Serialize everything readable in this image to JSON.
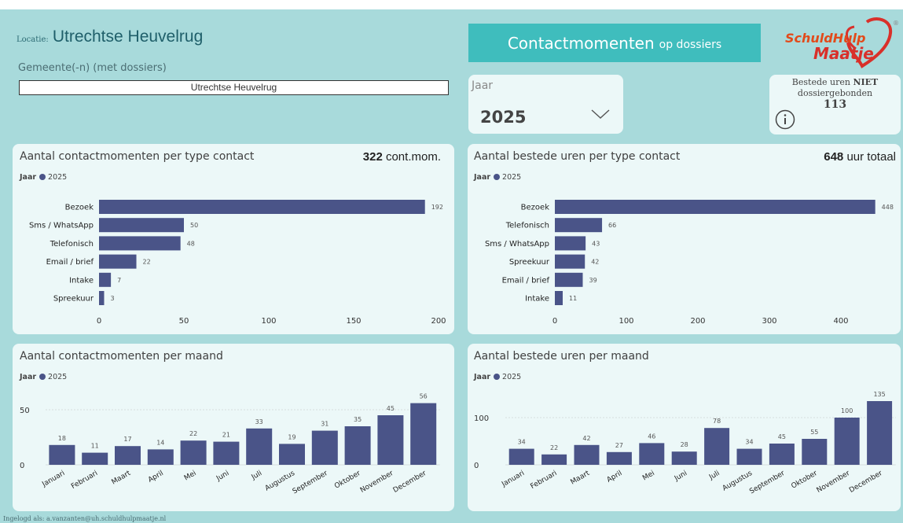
{
  "header": {
    "locatie_prefix": "Locatie:",
    "locatie_value": "Utrechtse Heuvelrug",
    "gemeente_label": "Gemeente(-n) (met dossiers)",
    "gemeente_value": "Utrechtse Heuvelrug",
    "title_main": "Contactmomenten",
    "title_sub": "op dossiers",
    "logo_line1": "SchuldHulp",
    "logo_line2": "Maatje",
    "logo_mark": "®"
  },
  "year_slicer": {
    "label": "Jaar",
    "value": "2025"
  },
  "info_card": {
    "line1": "Bestede uren",
    "line1_bold": "NIET",
    "line2": "dossiergebonden",
    "value": "113",
    "icon": "info-icon"
  },
  "panels": {
    "contact_type": {
      "title": "Aantal contactmomenten per type contact",
      "total_value": "322",
      "total_unit": "cont.mom.",
      "legend_label": "Jaar",
      "legend_year": "2025"
    },
    "hours_type": {
      "title": "Aantal bestede uren per type contact",
      "total_value": "648",
      "total_unit": "uur totaal",
      "legend_label": "Jaar",
      "legend_year": "2025"
    },
    "contact_month": {
      "title": "Aantal contactmomenten per maand",
      "legend_label": "Jaar",
      "legend_year": "2025"
    },
    "hours_month": {
      "title": "Aantal bestede uren per maand",
      "legend_label": "Jaar",
      "legend_year": "2025"
    }
  },
  "footer": {
    "login_text": "Ingelogd als: a.vanzanten@uh.schuldhulpmaatje.nl"
  },
  "colors": {
    "bar": "#4a5488",
    "background": "#a8dadb",
    "title_box": "#3fbdbd",
    "panel": "#ecf8f8"
  },
  "chart_data": [
    {
      "type": "bar",
      "orientation": "horizontal",
      "title": "Aantal contactmomenten per type contact",
      "categories": [
        "Bezoek",
        "Sms / WhatsApp",
        "Telefonisch",
        "Email / brief",
        "Intake",
        "Spreekuur"
      ],
      "values": [
        192,
        50,
        48,
        22,
        7,
        3
      ],
      "ticks": [
        0,
        50,
        100,
        150,
        200
      ],
      "xlim": [
        0,
        200
      ],
      "legend": "Jaar 2025"
    },
    {
      "type": "bar",
      "orientation": "horizontal",
      "title": "Aantal bestede uren per type contact",
      "categories": [
        "Bezoek",
        "Telefonisch",
        "Sms / WhatsApp",
        "Spreekuur",
        "Email / brief",
        "Intake"
      ],
      "values": [
        448,
        66,
        43,
        42,
        39,
        11
      ],
      "ticks": [
        0,
        100,
        200,
        300,
        400
      ],
      "xlim": [
        0,
        450
      ],
      "legend": "Jaar 2025"
    },
    {
      "type": "bar",
      "orientation": "vertical",
      "title": "Aantal contactmomenten per maand",
      "categories": [
        "Januari",
        "Februari",
        "Maart",
        "April",
        "Mei",
        "Juni",
        "Juli",
        "Augustus",
        "September",
        "Oktober",
        "November",
        "December"
      ],
      "values": [
        18,
        11,
        17,
        14,
        22,
        21,
        33,
        19,
        31,
        35,
        45,
        56
      ],
      "ticks": [
        0,
        50
      ],
      "ylim": [
        0,
        60
      ],
      "legend": "Jaar 2025"
    },
    {
      "type": "bar",
      "orientation": "vertical",
      "title": "Aantal bestede uren per maand",
      "categories": [
        "Januari",
        "Februari",
        "Maart",
        "April",
        "Mei",
        "Juni",
        "Juli",
        "Augustus",
        "September",
        "Oktober",
        "November",
        "December"
      ],
      "values": [
        34,
        22,
        42,
        27,
        46,
        28,
        78,
        34,
        45,
        55,
        100,
        135
      ],
      "ticks": [
        0,
        100
      ],
      "ylim": [
        0,
        140
      ],
      "legend": "Jaar 2025"
    }
  ]
}
